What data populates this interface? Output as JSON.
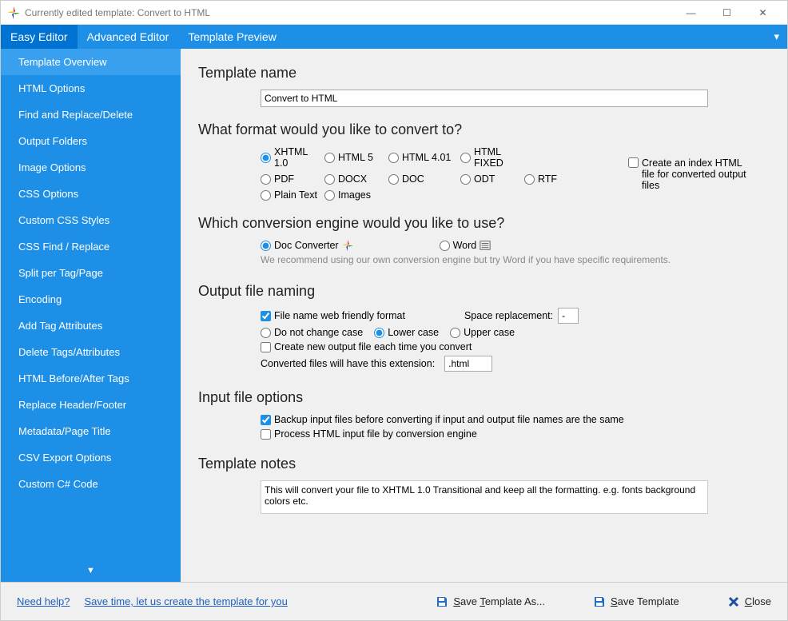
{
  "window": {
    "title": "Currently edited template: Convert to HTML"
  },
  "menubar": {
    "tabs": [
      "Easy Editor",
      "Advanced Editor",
      "Template Preview"
    ]
  },
  "sidebar": {
    "items": [
      "Template Overview",
      "HTML Options",
      "Find and Replace/Delete",
      "Output Folders",
      "Image Options",
      "CSS Options",
      "Custom CSS Styles",
      "CSS Find / Replace",
      "Split per Tag/Page",
      "Encoding",
      "Add Tag Attributes",
      "Delete Tags/Attributes",
      "HTML Before/After Tags",
      "Replace Header/Footer",
      "Metadata/Page Title",
      "CSV Export Options",
      "Custom C# Code"
    ]
  },
  "sections": {
    "templateName": {
      "heading": "Template name",
      "value": "Convert to HTML"
    },
    "format": {
      "heading": "What format would you like to convert to?",
      "options": [
        "XHTML 1.0",
        "HTML 5",
        "HTML 4.01",
        "HTML FIXED",
        "PDF",
        "DOCX",
        "DOC",
        "ODT",
        "RTF",
        "Plain Text",
        "Images"
      ],
      "indexCheckbox": "Create an index HTML file for converted output files"
    },
    "engine": {
      "heading": "Which conversion engine would you like to use?",
      "options": [
        "Doc Converter",
        "Word"
      ],
      "hint": "We recommend using our own conversion engine but try Word if you have specific requirements."
    },
    "naming": {
      "heading": "Output file naming",
      "webFriendly": "File name web friendly format",
      "spaceLabel": "Space replacement:",
      "spaceValue": "-",
      "caseOptions": [
        "Do not change case",
        "Lower case",
        "Upper case"
      ],
      "newfile": "Create new output file each time you convert",
      "extLabel": "Converted files will have this extension:",
      "extValue": ".html"
    },
    "input": {
      "heading": "Input file options",
      "backup": "Backup input files before converting if input and output file names are the same",
      "process": "Process HTML input file by conversion engine"
    },
    "notes": {
      "heading": "Template notes",
      "value": "This will convert your file to XHTML 1.0 Transitional and keep all the formatting. e.g. fonts background colors etc."
    }
  },
  "footer": {
    "help": "Need help?",
    "create": "Save time, let us create the template for you",
    "saveAs": "Save Template As...",
    "save": "Save Template",
    "close": "Close"
  }
}
